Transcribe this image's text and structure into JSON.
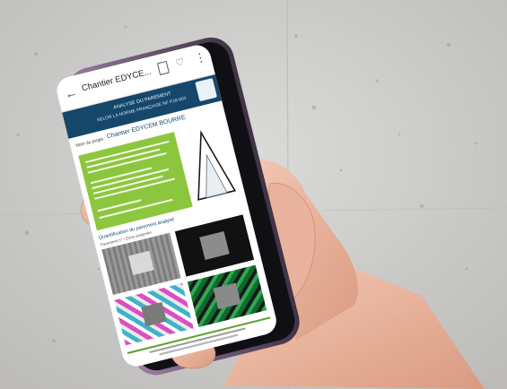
{
  "app_bar": {
    "back_icon": "arrow-left-icon",
    "title": "Chantier EDYCE...",
    "actions": [
      "document-icon",
      "bell-icon",
      "more-vert-icon"
    ]
  },
  "report": {
    "header_line1": "ANALYSE DU PAREMENT",
    "header_line2": "SELON LA NORME FRANÇAISE NF P18-503",
    "project_label": "Nom du projet :",
    "project_name": "Chantier EDYCEM BOURRE",
    "section_title": "Quantification du parement analysé",
    "legend": "Parement n° / Zone analysée",
    "colors": {
      "header_band": "#15476b",
      "summary_panel": "#8cc63f",
      "accent_green": "#5aa02c"
    }
  }
}
